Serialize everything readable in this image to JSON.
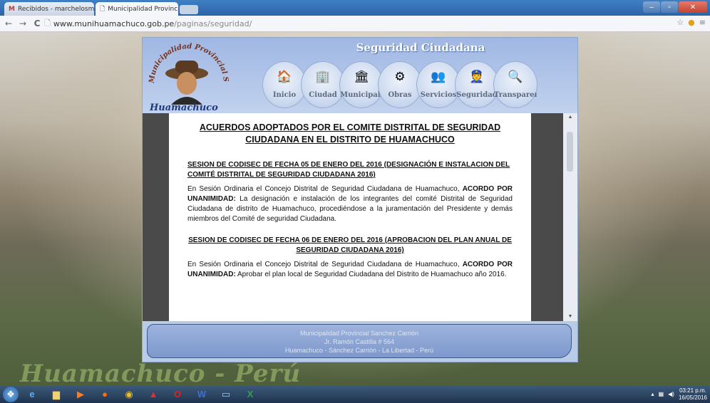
{
  "browser": {
    "tabs": [
      {
        "label": "Recibidos - marchelosmo",
        "icon": "gmail-icon",
        "active": false
      },
      {
        "label": "Municipalidad Provincial",
        "icon": "page-icon",
        "active": true
      }
    ],
    "url_host": "www.munihuamachuco.gob.pe",
    "url_path": "/paginas/seguridad/"
  },
  "site": {
    "title": "Seguridad Ciudadana",
    "logo_arc_text": "Municipalidad Provincial Sánchez Carrión",
    "logo_caption": "Huamachuco",
    "nav": [
      {
        "label": "Inicio",
        "icon": "house-icon"
      },
      {
        "label": "Ciudad",
        "icon": "building-icon"
      },
      {
        "label": "Municipalid",
        "icon": "city-hall-icon"
      },
      {
        "label": "Obras",
        "icon": "gear-icon"
      },
      {
        "label": "Servicios",
        "icon": "people-icon"
      },
      {
        "label": "Seguridad",
        "icon": "guard-icon"
      },
      {
        "label": "Transparenc",
        "icon": "magnifier-icon"
      }
    ]
  },
  "document": {
    "title": "ACUERDOS ADOPTADOS POR EL COMITE DISTRITAL DE SEGURIDAD CIUDADANA  EN  EL DISTRITO DE HUAMACHUCO",
    "sections": [
      {
        "heading": "SESION DE CODISEC DE FECHA  05 DE ENERO  DEL 2016 (DESIGNACIÓN E INSTALACION DEL COMITÉ DISTRITAL DE  SEGURIDAD CIUDADANA 2016)",
        "intro": "En Sesión Ordinaria el Concejo Distrital de Seguridad Ciudadana de Huamachuco, ",
        "bold": "ACORDO POR UNANIMIDAD:",
        "rest": " La designación e instalación de los integrantes del comité Distrital de Seguridad Ciudadana de distrito de Huamachuco, procediéndose a la juramentación del Presidente y demás miembros  del Comité de seguridad Ciudadana."
      },
      {
        "heading": "SESION DE CODISEC DE FECHA  06 DE ENERO  DEL 2016 (APROBACION DEL PLAN ANUAL DE SEGURIDAD CIUDADANA 2016)",
        "intro": "En Sesión Ordinaria el Concejo Distrital de Seguridad Ciudadana de Huamachuco, ",
        "bold": "ACORDO POR UNANIMIDAD:",
        "rest": " Aprobar el  plan local de Seguridad Ciudadana del Distrito de Huamachuco año 2016."
      }
    ]
  },
  "footer": {
    "line1": "Municipalidad Provincial Sanchez Carrión",
    "line2": "Jr. Ramón Castilla # 564",
    "line3": "Huamachuco - Sánchez Carrión - La Libertad - Perú"
  },
  "background_watermark": "Huamachuco - Perú",
  "taskbar": {
    "apps": [
      "start-orb-icon",
      "internet-explorer-icon",
      "folder-icon",
      "media-player-icon",
      "firefox-icon",
      "chrome-icon",
      "acrobat-icon",
      "opera-icon",
      "word-icon",
      "window-icon",
      "excel-icon"
    ],
    "time": "03:21 p.m.",
    "date": "16/05/2016"
  }
}
